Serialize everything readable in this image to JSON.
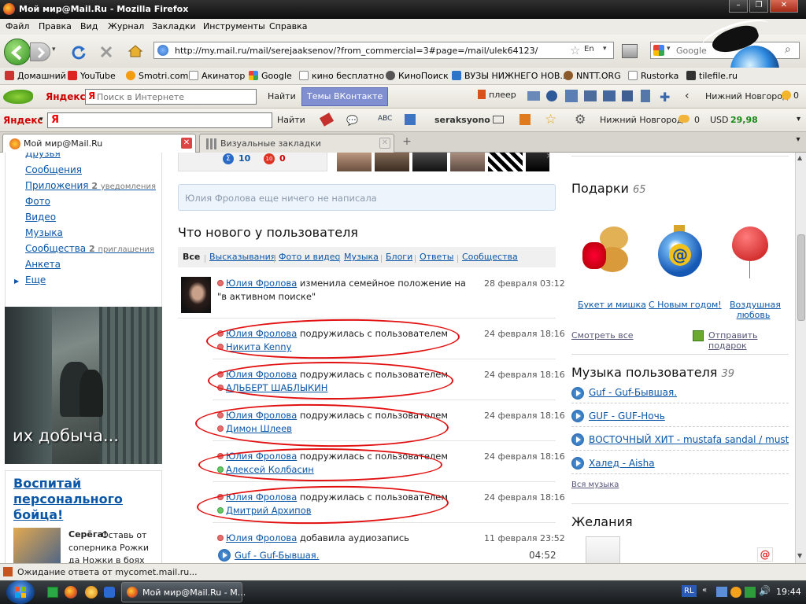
{
  "window": {
    "title": "Мой мир@Mail.Ru - Mozilla Firefox"
  },
  "menu": [
    "Файл",
    "Правка",
    "Вид",
    "Журнал",
    "Закладки",
    "Инструменты",
    "Справка"
  ],
  "nav": {
    "url": "http://my.mail.ru/mail/serejaaksenov/?from_commercial=3#page=/mail/ulek64123/",
    "search_placeholder": "Google",
    "lang_badge": "En"
  },
  "bookmarks": [
    "Домашний",
    "YouTube",
    "Smotri.com",
    "Акинатор",
    "Google",
    "кино бесплатно",
    "КиноПоиск",
    "ВУЗЫ НИЖНЕГО НОВ...",
    "NNTT.ORG",
    "Rustorka",
    "tilefile.ru"
  ],
  "ybar1": {
    "logo": "Яндекс",
    "search_placeholder": "Поиск в Интернете",
    "find": "Найти",
    "vk_themes": "Темы ВКонтакте",
    "player": "плеер",
    "city": "Нижний Новгород",
    "temp": "0"
  },
  "ybar2": {
    "logo": "Яндекс",
    "find": "Найти",
    "user": "seraksyono",
    "city": "Нижний Новгород",
    "weather": "0",
    "usd_label": "USD",
    "usd_value": "29,98"
  },
  "tabs": [
    {
      "label": "Мой мир@Mail.Ru"
    },
    {
      "label": "Визуальные закладки"
    }
  ],
  "sidebar": {
    "items": [
      {
        "label": "Друзья"
      },
      {
        "label": "Сообщения"
      },
      {
        "label": "Приложения",
        "badge": "2",
        "note": "уведомления"
      },
      {
        "label": "Фото"
      },
      {
        "label": "Видео"
      },
      {
        "label": "Музыка"
      },
      {
        "label": "Сообщества",
        "badge": "2",
        "note": "приглашения"
      },
      {
        "label": "Анкета"
      },
      {
        "label": "Еще"
      }
    ],
    "ad_caption": "их добыча...",
    "promo": {
      "title": "Воспитай персонального бойца!",
      "author": "Серёга!",
      "text": "Оставь от соперника Рожки да Ножки в боях на"
    }
  },
  "profile": {
    "counter_votes": "10",
    "counter_score": "0",
    "status_empty": "Юлия Фролова еще ничего не написала"
  },
  "feed": {
    "title": "Что нового у пользователя",
    "filters": [
      "Все",
      "Высказывания",
      "Фото и видео",
      "Музыка",
      "Блоги",
      "Ответы",
      "Сообщества"
    ],
    "events": [
      {
        "actor": "Юлия Фролова",
        "action": "изменила семейное положение на",
        "target": "\"в активном поиске\"",
        "date": "28 февраля 03:12"
      },
      {
        "actor": "Юлия Фролова",
        "action": "подружилась с пользователем",
        "target": "Никита Kenny",
        "date": "24 февраля 18:16"
      },
      {
        "actor": "Юлия Фролова",
        "action": "подружилась с пользователем",
        "target": "АЛЬБЕРТ ШАБЛЫКИН",
        "date": "24 февраля 18:16"
      },
      {
        "actor": "Юлия Фролова",
        "action": "подружилась с пользователем",
        "target": "Димон Шлеев",
        "date": "24 февраля 18:16"
      },
      {
        "actor": "Юлия Фролова",
        "action": "подружилась с пользователем",
        "target": "Алексей Колбасин",
        "date": "24 февраля 18:16"
      },
      {
        "actor": "Юлия Фролова",
        "action": "подружилась с пользователем",
        "target": "Дмитрий Архипов",
        "date": "24 февраля 18:16"
      },
      {
        "actor": "Юлия Фролова",
        "action": "добавила аудиозапись",
        "target": "Guf - Guf-Бывшая.",
        "date": "11 февраля 23:52",
        "duration": "04:52"
      }
    ]
  },
  "gifts": {
    "title": "Подарки",
    "count": "65",
    "items": [
      {
        "label": "Букет и мишка"
      },
      {
        "label": "С Новым годом!"
      },
      {
        "label": "Воздушная любовь"
      }
    ],
    "see_all": "Смотреть все",
    "send": "Отправить подарок"
  },
  "music": {
    "title": "Музыка пользователя",
    "count": "39",
    "tracks": [
      "Guf - Guf-Бывшая.",
      "GUF - GUF-Ночь",
      "ВОСТОЧНЫЙ ХИТ - mustafa sandal / mustafa",
      "Халед - Aisha"
    ],
    "all": "Вся музыка"
  },
  "wishes": {
    "title": "Желания"
  },
  "status": {
    "text": "Ожидание ответа от mycomet.mail.ru..."
  },
  "taskbar": {
    "app": "Мой мир@Mail.Ru - М...",
    "lang": "RL",
    "time": "19:44"
  }
}
